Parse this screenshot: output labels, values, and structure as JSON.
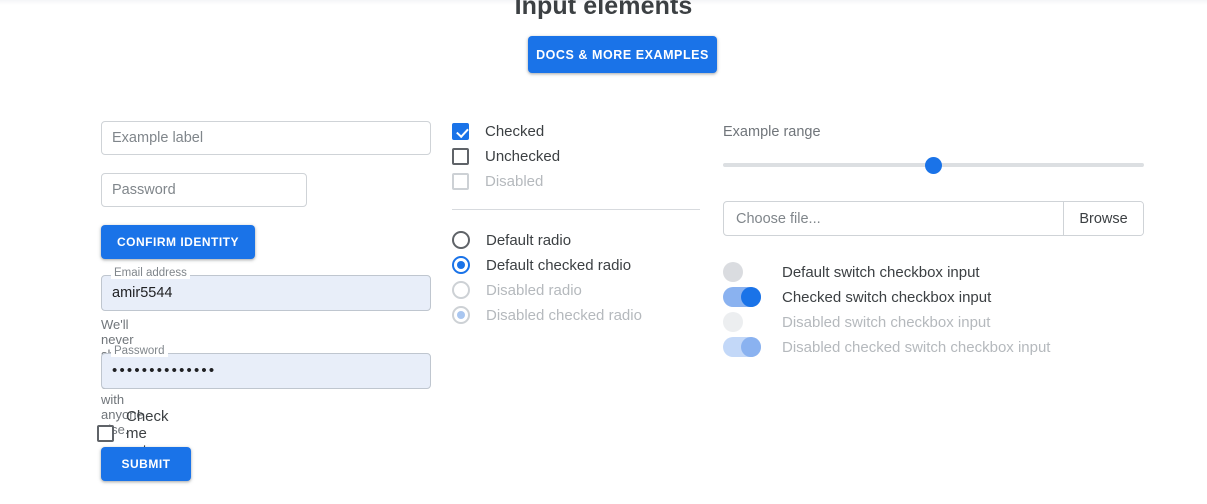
{
  "header": {
    "title": "Input elements",
    "docs_button": "DOCS & MORE EXAMPLES"
  },
  "colors": {
    "accent": "#1a73e8",
    "accent_light": "#8ab2f0",
    "text": "#3c4043",
    "muted": "#80868b",
    "disabled": "#b5b9bd",
    "field_fill": "#e8eef9",
    "border": "#cfd3d7"
  },
  "form_column": {
    "example_input": {
      "placeholder": "Example label",
      "value": ""
    },
    "password_input": {
      "placeholder": "Password",
      "value": ""
    },
    "confirm_button": "CONFIRM IDENTITY",
    "email_field": {
      "label": "Email address",
      "value": "amir5544"
    },
    "email_help": "We'll never share your email with anyone else.",
    "password_field": {
      "label": "Password",
      "value": "••••••••••••••"
    },
    "check_me_out": "Check me out",
    "submit_button": "SUBMIT"
  },
  "checkbox_column": {
    "checkboxes": [
      {
        "label": "Checked",
        "checked": true,
        "disabled": false
      },
      {
        "label": "Unchecked",
        "checked": false,
        "disabled": false
      },
      {
        "label": "Disabled",
        "checked": false,
        "disabled": true
      }
    ],
    "radios": [
      {
        "label": "Default radio",
        "checked": false,
        "disabled": false
      },
      {
        "label": "Default checked radio",
        "checked": true,
        "disabled": false
      },
      {
        "label": "Disabled radio",
        "checked": false,
        "disabled": true
      },
      {
        "label": "Disabled checked radio",
        "checked": true,
        "disabled": true
      }
    ]
  },
  "right_column": {
    "range": {
      "label": "Example range",
      "value": 50,
      "min": 0,
      "max": 100
    },
    "file": {
      "placeholder": "Choose file...",
      "browse_label": "Browse"
    },
    "switches": [
      {
        "label": "Default switch checkbox input",
        "checked": false,
        "disabled": false
      },
      {
        "label": "Checked switch checkbox input",
        "checked": true,
        "disabled": false
      },
      {
        "label": "Disabled switch checkbox input",
        "checked": false,
        "disabled": true
      },
      {
        "label": "Disabled checked switch checkbox input",
        "checked": true,
        "disabled": true
      }
    ]
  }
}
